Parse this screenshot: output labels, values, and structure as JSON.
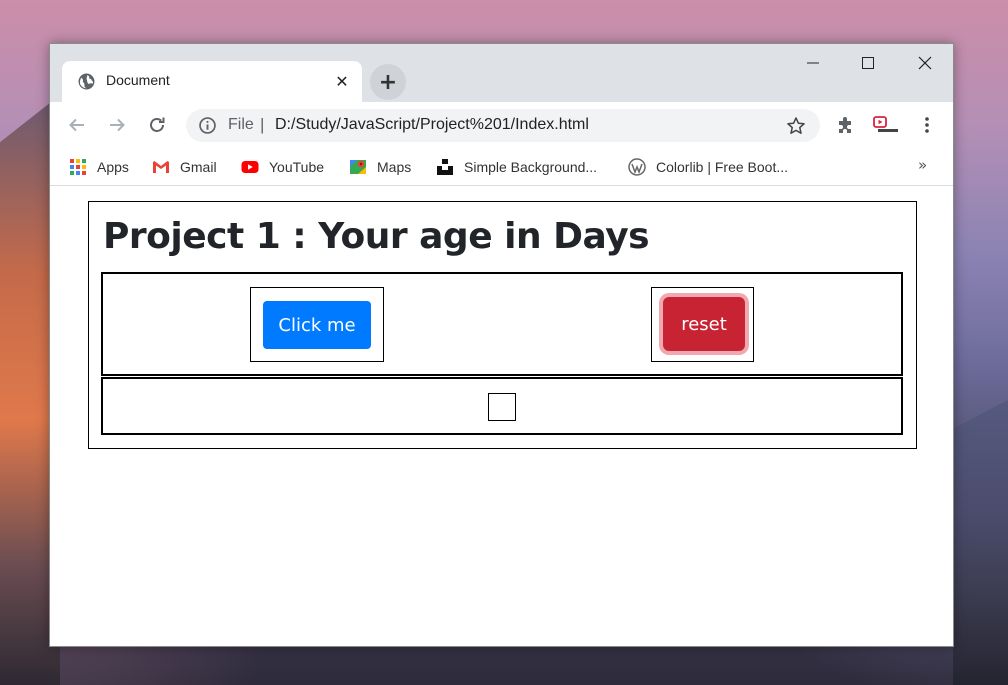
{
  "browser": {
    "tab": {
      "title": "Document",
      "icon": "globe-icon"
    },
    "new_tab_icon": "plus-icon",
    "window_controls": [
      "minimize-icon",
      "maximize-icon",
      "close-icon"
    ],
    "address_bar": {
      "scheme_label": "File",
      "separator": "|",
      "url": "D:/Study/JavaScript/Project%201/Index.html"
    },
    "bookmarks": [
      {
        "label": "Apps",
        "icon": "apps-grid-icon"
      },
      {
        "label": "Gmail",
        "icon": "gmail-icon"
      },
      {
        "label": "YouTube",
        "icon": "youtube-icon"
      },
      {
        "label": "Maps",
        "icon": "maps-icon"
      },
      {
        "label": "Simple Background...",
        "icon": "unsplash-icon"
      },
      {
        "label": "Colorlib | Free Boot...",
        "icon": "wordpress-icon"
      }
    ],
    "bookmarks_more": "»"
  },
  "page": {
    "heading": "Project 1 : Your age in Days",
    "click_button_label": "Click me",
    "reset_button_label": "reset",
    "colors": {
      "primary_button": "#007bff",
      "danger_button": "#c82333"
    }
  }
}
